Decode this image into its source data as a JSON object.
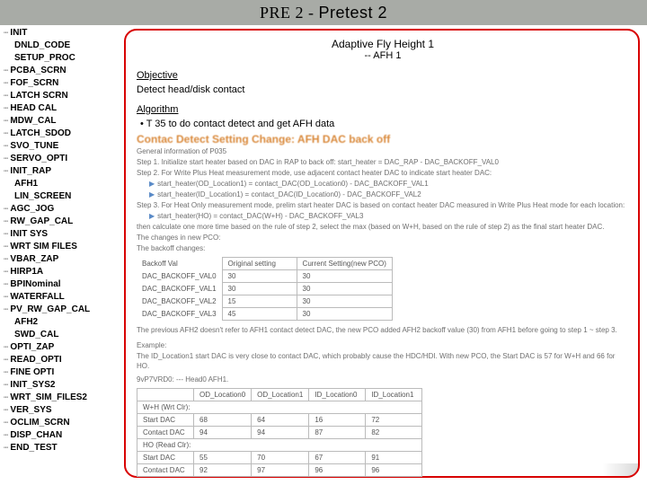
{
  "title_left": "PRE 2",
  "title_sep": " - ",
  "title_right": "Pretest 2",
  "sidebar": {
    "items": [
      {
        "label": "INIT",
        "child": false
      },
      {
        "label": "DNLD_CODE",
        "child": true
      },
      {
        "label": "SETUP_PROC",
        "child": true
      },
      {
        "label": "PCBA_SCRN",
        "child": false
      },
      {
        "label": "FOF_SCRN",
        "child": false
      },
      {
        "label": "LATCH SCRN",
        "child": false
      },
      {
        "label": "HEAD CAL",
        "child": false
      },
      {
        "label": "MDW_CAL",
        "child": false
      },
      {
        "label": "LATCH_SDOD",
        "child": false
      },
      {
        "label": "SVO_TUNE",
        "child": false
      },
      {
        "label": "SERVO_OPTI",
        "child": false
      },
      {
        "label": "INIT_RAP",
        "child": false
      },
      {
        "label": "AFH1",
        "child": true
      },
      {
        "label": "LIN_SCREEN",
        "child": true
      },
      {
        "label": "AGC_JOG",
        "child": false
      },
      {
        "label": "RW_GAP_CAL",
        "child": false
      },
      {
        "label": "INIT SYS",
        "child": false
      },
      {
        "label": "WRT SIM FILES",
        "child": false
      },
      {
        "label": "VBAR_ZAP",
        "child": false
      },
      {
        "label": "HIRP1A",
        "child": false
      },
      {
        "label": "BPINominal",
        "child": false
      },
      {
        "label": "WATERFALL",
        "child": false
      },
      {
        "label": "PV_RW_GAP_CAL",
        "child": false
      },
      {
        "label": "AFH2",
        "child": true
      },
      {
        "label": "SWD_CAL",
        "child": true
      },
      {
        "label": "OPTI_ZAP",
        "child": false
      },
      {
        "label": "READ_OPTI",
        "child": false
      },
      {
        "label": "FINE OPTI",
        "child": false
      },
      {
        "label": "INIT_SYS2",
        "child": false
      },
      {
        "label": "WRT_SIM_FILES2",
        "child": false
      },
      {
        "label": "VER_SYS",
        "child": false
      },
      {
        "label": "OCLIM_SCRN",
        "child": false
      },
      {
        "label": "DISP_CHAN",
        "child": false
      },
      {
        "label": "END_TEST",
        "child": false
      }
    ]
  },
  "panel": {
    "heading": "Adaptive Fly Height 1",
    "sub": "-- AFH 1",
    "objective_h": "Objective",
    "objective_body": "Detect head/disk contact",
    "algorithm_h": "Algorithm",
    "algorithm_bullet": "T 35 to do contact detect and get AFH data"
  },
  "doc": {
    "title": "Contac Detect Setting Change: AFH DAC back off",
    "info_line": "General information of P035",
    "steps": [
      "Step 1. Initialize start heater based on DAC in RAP to back off: start_heater = DAC_RAP - DAC_BACKOFF_VAL0",
      "Step 2. For Write Plus Heat measurement mode, use adjacent contact heater DAC to indicate start heater DAC:",
      "start_heater(OD_Location1) = contact_DAC(OD_Location0) - DAC_BACKOFF_VAL1",
      "start_heater(ID_Location1) = contact_DAC(ID_Location0) - DAC_BACKOFF_VAL2",
      "Step 3. For Heat Only measurement mode, prelim start heater DAC is based on contact heater DAC measured in Write Plus Heat mode for each location:",
      "start_heater(HO) = contact_DAC(W+H) - DAC_BACKOFF_VAL3",
      "then calculate one more time based on the rule of step 2, select the max (based on W+H, based on the rule of step 2) as the final start heater DAC.",
      "The changes in new PCO:",
      "The backoff changes:"
    ],
    "backoff": {
      "headers": [
        "Backoff Val",
        "Original setting",
        "Current Setting(new PCO)"
      ],
      "rows": [
        [
          "DAC_BACKOFF_VAL0",
          "30",
          "30"
        ],
        [
          "DAC_BACKOFF_VAL1",
          "30",
          "30"
        ],
        [
          "DAC_BACKOFF_VAL2",
          "15",
          "30"
        ],
        [
          "DAC_BACKOFF_VAL3",
          "45",
          "30"
        ]
      ]
    },
    "note": "The previous AFH2 doesn't refer to AFH1 contact detect DAC, the new PCO added AFH2 backoff value (30) from AFH1 before going to step 1 ~ step 3.",
    "example_h": "Example:",
    "example_line1": "The ID_Location1 start DAC is very close to contact DAC, which probably cause the HDC/HDI. With new PCO, the Start DAC is 57 for W+H and 66 for HO.",
    "example_meta": "9vP7VRD0: --- Head0    AFH1.",
    "example_table": {
      "headers": [
        "",
        "OD_Location0",
        "OD_Location1",
        "ID_Location0",
        "ID_Location1"
      ],
      "sections": [
        {
          "name": "W+H (Wrt Clr):",
          "rows": [
            [
              "Start DAC",
              "68",
              "64",
              "16",
              "72"
            ],
            [
              "Contact DAC",
              "94",
              "94",
              "87",
              "82"
            ]
          ]
        },
        {
          "name": "HO (Read Clr):",
          "rows": [
            [
              "Start DAC",
              "55",
              "70",
              "67",
              "91"
            ],
            [
              "Contact DAC",
              "92",
              "97",
              "96",
              "96"
            ]
          ]
        }
      ]
    }
  }
}
